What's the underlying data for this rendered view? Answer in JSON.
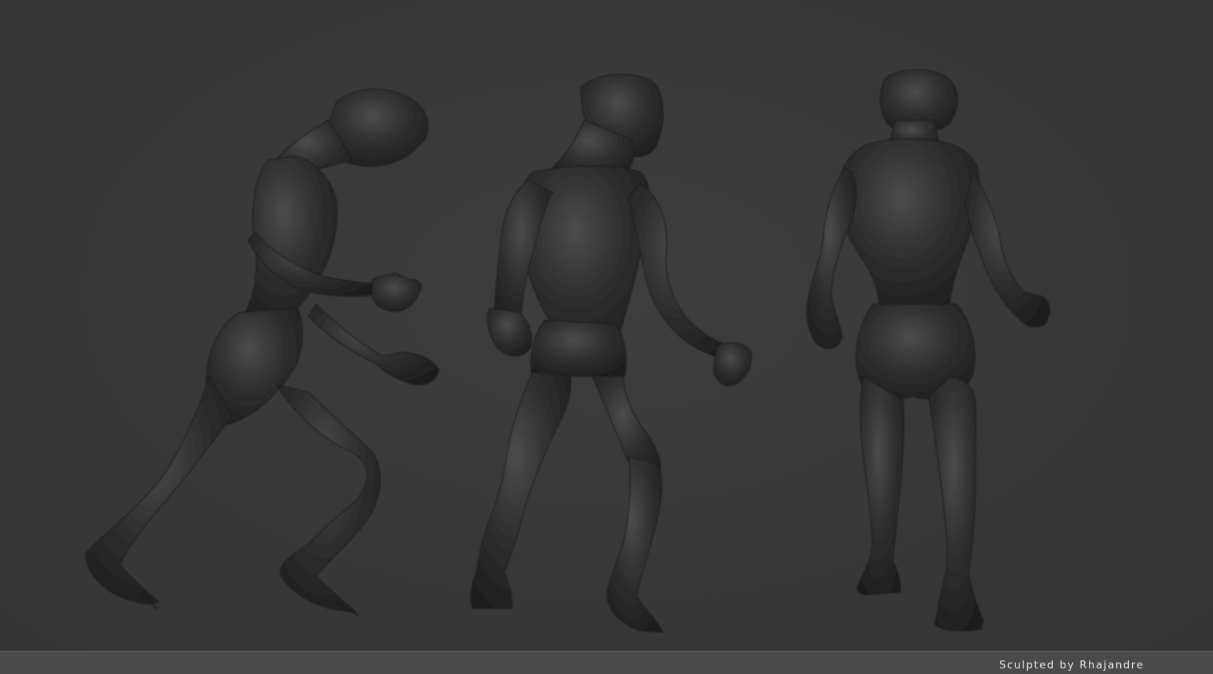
{
  "scene": {
    "background_color": "#383838",
    "figure_color": "#2a2a2a",
    "figures": [
      {
        "view": "side"
      },
      {
        "view": "front-three-quarter"
      },
      {
        "view": "back"
      }
    ]
  },
  "footer": {
    "credit": "Sculpted by Rhajandre",
    "bar_color": "#4a4a4a"
  }
}
